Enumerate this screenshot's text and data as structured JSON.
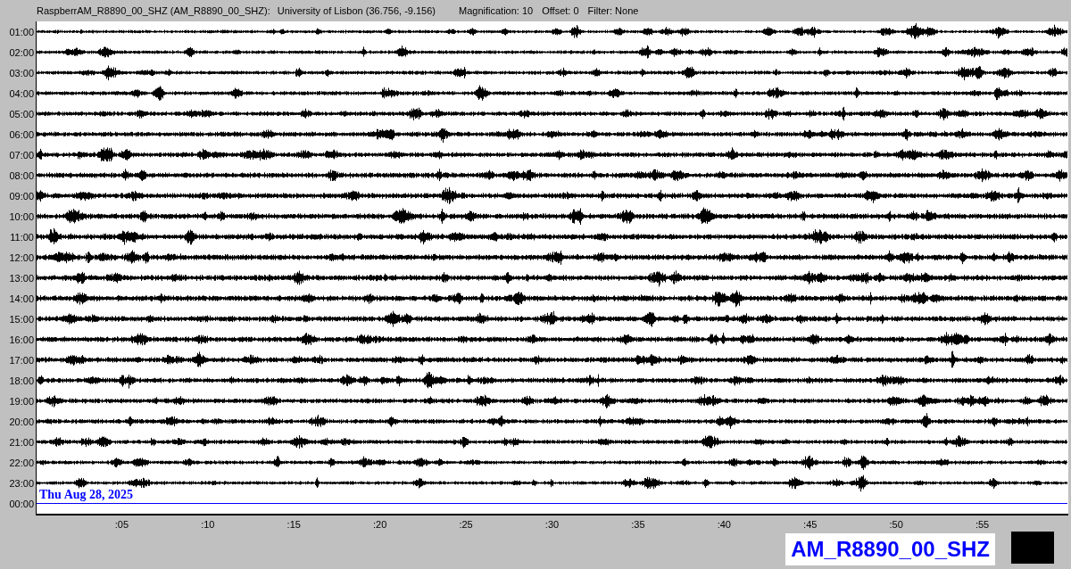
{
  "header": {
    "station": "RaspberrAM_R8890_00_SHZ (AM_R8890_00_SHZ):",
    "location": "University of Lisbon (36.756, -9.156)",
    "magnification": "Magnification: 10",
    "offset": "Offset: 0",
    "filter": "Filter: None"
  },
  "rows": [
    {
      "time": "01:00",
      "kind": "trace"
    },
    {
      "time": "02:00",
      "kind": "trace"
    },
    {
      "time": "03:00",
      "kind": "trace"
    },
    {
      "time": "04:00",
      "kind": "trace"
    },
    {
      "time": "05:00",
      "kind": "trace"
    },
    {
      "time": "06:00",
      "kind": "trace"
    },
    {
      "time": "07:00",
      "kind": "trace"
    },
    {
      "time": "08:00",
      "kind": "trace"
    },
    {
      "time": "09:00",
      "kind": "trace"
    },
    {
      "time": "10:00",
      "kind": "trace"
    },
    {
      "time": "11:00",
      "kind": "trace"
    },
    {
      "time": "12:00",
      "kind": "trace"
    },
    {
      "time": "13:00",
      "kind": "trace"
    },
    {
      "time": "14:00",
      "kind": "trace"
    },
    {
      "time": "15:00",
      "kind": "trace"
    },
    {
      "time": "16:00",
      "kind": "trace"
    },
    {
      "time": "17:00",
      "kind": "trace"
    },
    {
      "time": "18:00",
      "kind": "trace"
    },
    {
      "time": "19:00",
      "kind": "trace"
    },
    {
      "time": "20:00",
      "kind": "trace"
    },
    {
      "time": "21:00",
      "kind": "trace"
    },
    {
      "time": "22:00",
      "kind": "trace"
    },
    {
      "time": "23:00",
      "kind": "trace"
    },
    {
      "time": "00:00",
      "kind": "current"
    }
  ],
  "date": "Thu Aug 28, 2025",
  "minute_ticks": [
    ":05",
    ":10",
    ":15",
    ":20",
    ":25",
    ":30",
    ":35",
    ":40",
    ":45",
    ":50",
    ":55"
  ],
  "channel_label": "AM_R8890_00_SHZ"
}
